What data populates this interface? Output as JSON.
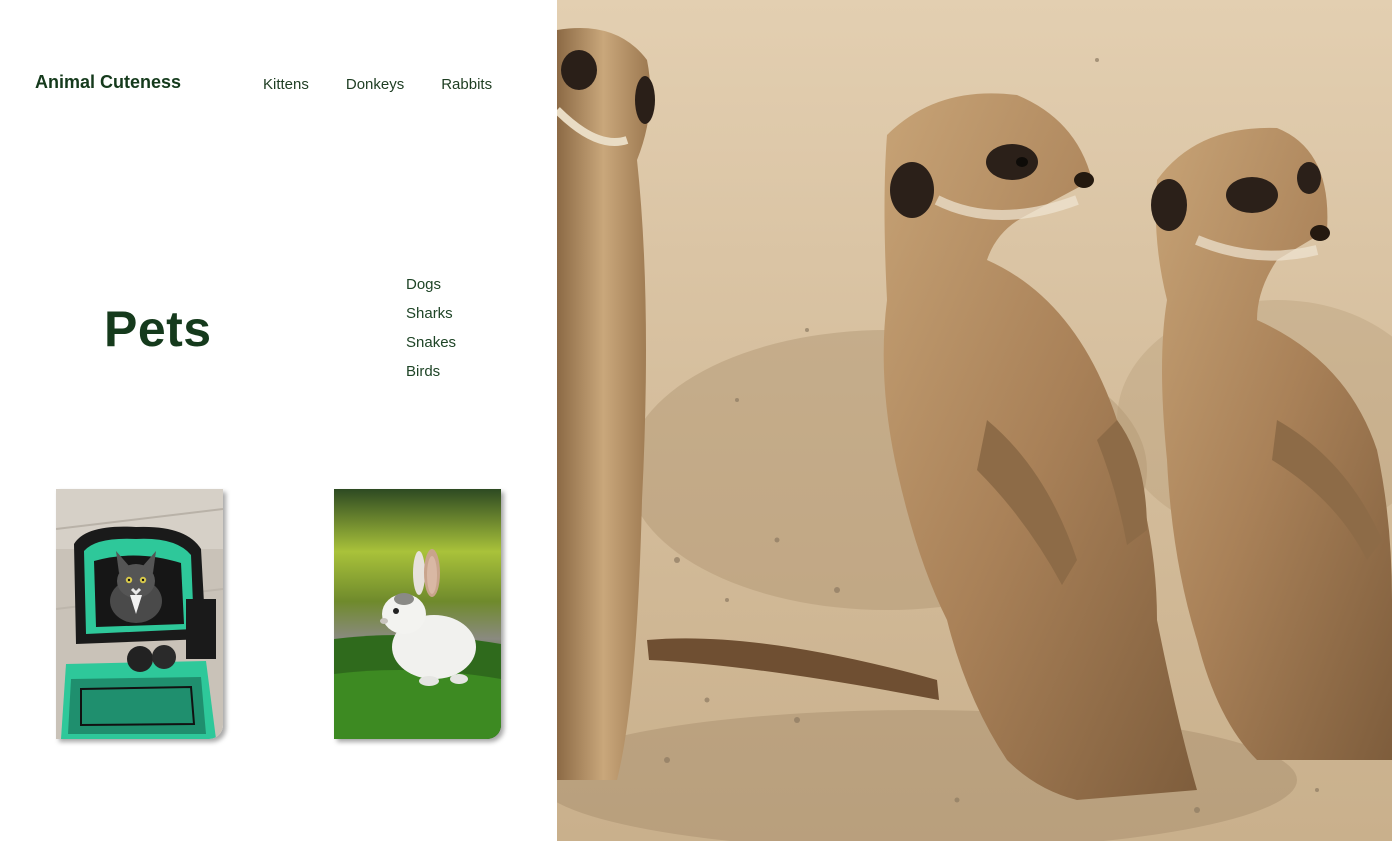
{
  "header": {
    "brand": "Animal Cuteness",
    "nav": [
      "Kittens",
      "Donkeys",
      "Rabbits"
    ]
  },
  "hero": {
    "title": "Pets",
    "links": [
      "Dogs",
      "Sharks",
      "Snakes",
      "Birds"
    ]
  },
  "colors": {
    "text_green": "#153a1c",
    "accent_teal": "#2ec89a"
  }
}
